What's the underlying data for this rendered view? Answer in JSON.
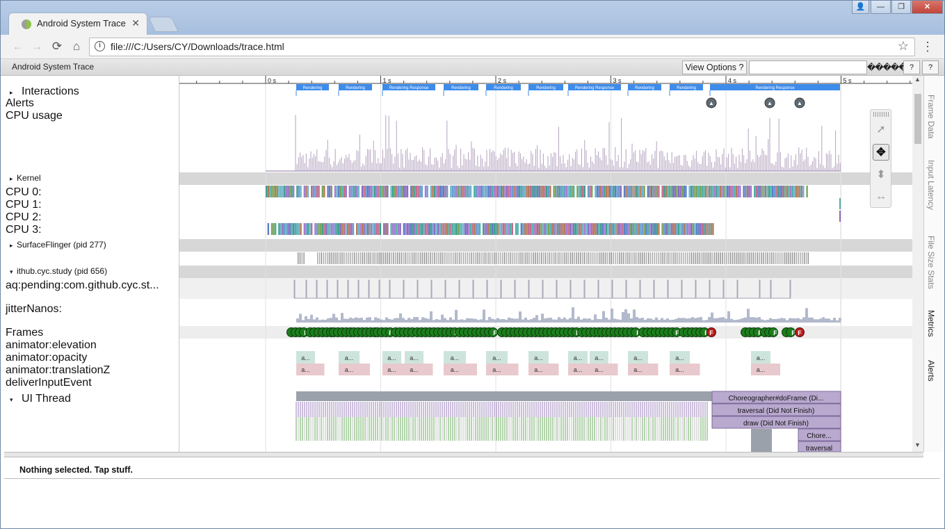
{
  "browser": {
    "tab_title": "Android System Trace",
    "tab_close_glyph": "✕",
    "inactive_tab_title": "",
    "url": "file:///C:/Users/CY/Downloads/trace.html",
    "window_buttons": {
      "user": "👤",
      "minimize": "—",
      "maximize": "❐",
      "close": "✕"
    },
    "nav": {
      "back": "←",
      "forward": "→",
      "reload": "⟳",
      "home": "⌂",
      "info": "i",
      "bookmark": "☆",
      "menu": "⋮"
    }
  },
  "viewer": {
    "title": "Android System Trace",
    "view_options_label": "View Options ?",
    "search_value": "",
    "search_buttons_text": "������",
    "help_label_1": "?",
    "help_label_2": "?"
  },
  "ruler": {
    "ticks": [
      "0 s",
      "1 s",
      "2 s",
      "3 s",
      "4 s",
      "5 s"
    ]
  },
  "interactions": {
    "label": "Interactions",
    "slices": [
      "Rendering",
      "Rendering",
      "Rendering Response",
      "Rendering",
      "Rendering",
      "Rendering",
      "Rendering Response",
      "Rendering",
      "Rendering",
      "Rendering Response"
    ]
  },
  "tracks": {
    "alerts": "Alerts",
    "cpu_usage": "CPU usage",
    "kernel_group": "Kernel",
    "cpus": [
      "CPU 0:",
      "CPU 1:",
      "CPU 2:",
      "CPU 3:"
    ],
    "surfaceflinger_group": "SurfaceFlinger (pid 277)",
    "app_group": "ithub.cyc.study (pid 656)",
    "aq_pending": "aq:pending:com.github.cyc.st...",
    "jitter": "jitterNanos:",
    "frames": "Frames",
    "animator_elevation": "animator:elevation",
    "animator_opacity": "animator:opacity",
    "animator_translation": "animator:translationZ",
    "deliver_input": "deliverInputEvent",
    "ui_thread": "UI Thread"
  },
  "frames": {
    "good_glyph": "F",
    "bad_glyph": "F"
  },
  "animator_abbrev": "a...",
  "ui_slices": [
    "Choreographer#doFrame (Di...",
    "traversal (Did Not Finish)",
    "draw (Did Not Finish)",
    "Chore...",
    "traversal"
  ],
  "side_panel": [
    "Frame Data",
    "Input Latency",
    "File Size Stats",
    "Metrics",
    "Alerts"
  ],
  "mouse_modes": {
    "select": "➚",
    "pan": "✥",
    "zoom": "⬍",
    "timing": "↔"
  },
  "scroll": {
    "up": "▲",
    "down": "▼"
  },
  "analysis": {
    "status": "Nothing selected. Tap stuff."
  },
  "colors": {
    "interaction_blue": "#3d8bea",
    "alert_gray": "#5f6b73",
    "cpu_usage": "#b2a2be",
    "group_header": "#d7d7d7",
    "frame_good": "#1d7d1d",
    "frame_bad": "#b71c1c",
    "animator_green": "#cde4dc",
    "animator_pink": "#e8c9cd",
    "ui_purple": "#9a7fb8",
    "ui_green": "#6aaa5c"
  }
}
